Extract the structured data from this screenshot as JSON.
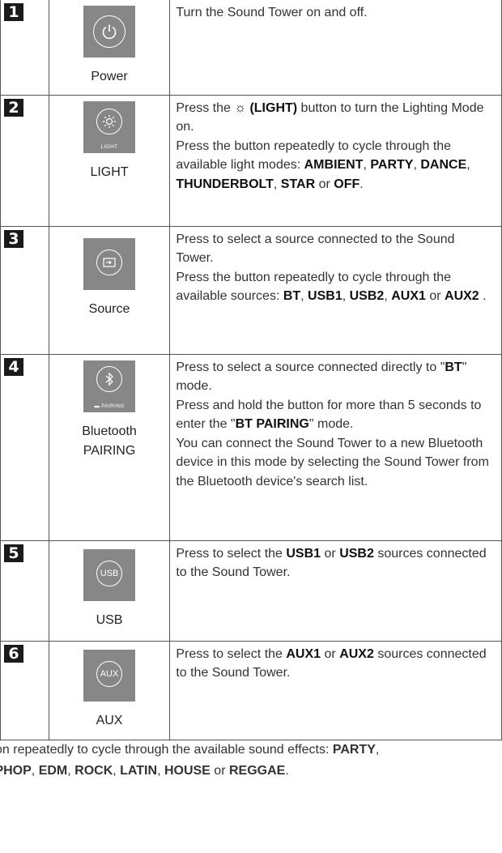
{
  "rows": [
    {
      "number": "1",
      "icon": "power-icon",
      "label": "Power",
      "description": [
        {
          "t": "Turn the Sound Tower on and off."
        }
      ]
    },
    {
      "number": "2",
      "icon": "light-icon",
      "caption": "LIGHT",
      "label": "LIGHT",
      "description": [
        {
          "t": "Press the "
        },
        {
          "t": "☼ (LIGHT)",
          "b": true
        },
        {
          "t": " button to turn the Lighting Mode on."
        },
        {
          "br": true
        },
        {
          "t": "Press the button repeatedly to cycle through the available light modes: "
        },
        {
          "t": "AMBIENT",
          "b": true
        },
        {
          "t": ", "
        },
        {
          "t": "PARTY",
          "b": true
        },
        {
          "t": ", "
        },
        {
          "t": "DANCE",
          "b": true
        },
        {
          "t": ", "
        },
        {
          "t": "THUNDERBOLT",
          "b": true
        },
        {
          "t": ", "
        },
        {
          "t": "STAR",
          "b": true
        },
        {
          "t": " or "
        },
        {
          "t": "OFF",
          "b": true
        },
        {
          "t": "."
        }
      ]
    },
    {
      "number": "3",
      "icon": "source-icon",
      "label": "Source",
      "description": [
        {
          "t": "Press to select a source connected to the Sound Tower."
        },
        {
          "br": true
        },
        {
          "t": "Press the button repeatedly to cycle through the available sources: "
        },
        {
          "t": "BT",
          "b": true
        },
        {
          "t": ", "
        },
        {
          "t": "USB1",
          "b": true
        },
        {
          "t": ", "
        },
        {
          "t": "USB2",
          "b": true
        },
        {
          "t": ", "
        },
        {
          "t": "AUX1",
          "b": true
        },
        {
          "t": " or "
        },
        {
          "t": "AUX2",
          "b": true
        },
        {
          "t": " ."
        }
      ]
    },
    {
      "number": "4",
      "icon": "bluetooth-icon",
      "caption": "PAIRING",
      "label": "Bluetooth PAIRING",
      "description": [
        {
          "t": "Press to select a source connected directly to \""
        },
        {
          "t": "BT",
          "b": true
        },
        {
          "t": "\" mode."
        },
        {
          "br": true
        },
        {
          "t": "Press and hold the button for more than 5 seconds to enter the \""
        },
        {
          "t": "BT PAIRING",
          "b": true
        },
        {
          "t": "\" mode."
        },
        {
          "br": true
        },
        {
          "t": "You can connect the Sound Tower to a new Bluetooth device in this mode by selecting the Sound Tower from the Bluetooth device's search list."
        }
      ]
    },
    {
      "number": "5",
      "icon": "usb-icon",
      "circle_text": "USB",
      "label": "USB",
      "description": [
        {
          "t": "Press to select the "
        },
        {
          "t": "USB1",
          "b": true
        },
        {
          "t": " or "
        },
        {
          "t": "USB2",
          "b": true
        },
        {
          "t": " sources connected to the Sound Tower."
        }
      ]
    },
    {
      "number": "6",
      "icon": "aux-icon",
      "circle_text": "AUX",
      "label": "AUX",
      "description": [
        {
          "t": "Press to select the "
        },
        {
          "t": "AUX1",
          "b": true
        },
        {
          "t": " or "
        },
        {
          "t": "AUX2",
          "b": true
        },
        {
          "t": " sources connected to the Sound Tower."
        }
      ]
    }
  ],
  "footer": {
    "line1": [
      {
        "t": "on repeatedly to cycle through the available sound effects: "
      },
      {
        "t": "PARTY",
        "b": true
      },
      {
        "t": ","
      }
    ],
    "line2": [
      {
        "t": "IPHOP",
        "b": true
      },
      {
        "t": ", "
      },
      {
        "t": "EDM",
        "b": true
      },
      {
        "t": ", "
      },
      {
        "t": "ROCK",
        "b": true
      },
      {
        "t": ", "
      },
      {
        "t": "LATIN",
        "b": true
      },
      {
        "t": ", "
      },
      {
        "t": "HOUSE",
        "b": true
      },
      {
        "t": " or "
      },
      {
        "t": "REGGAE",
        "b": true
      },
      {
        "t": "."
      }
    ]
  }
}
